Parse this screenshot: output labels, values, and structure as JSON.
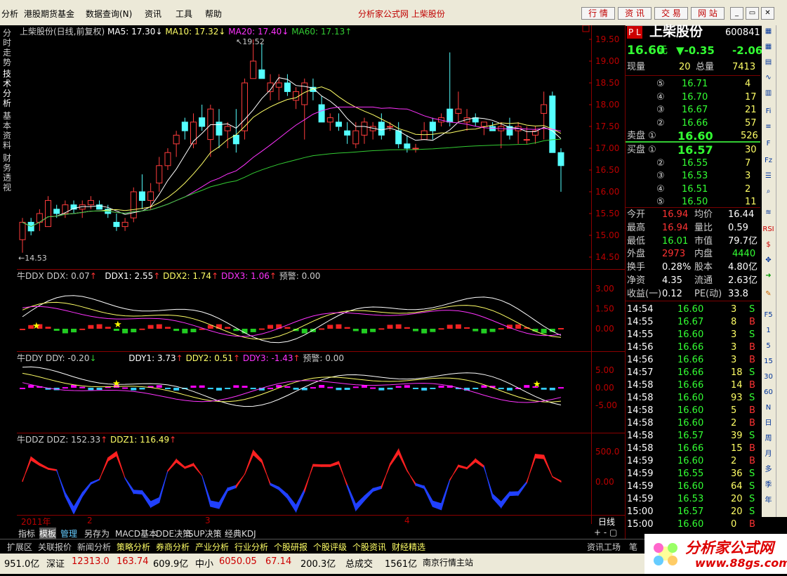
{
  "menu": {
    "items": [
      "分析",
      "港股期货基金",
      "数据查询(N)",
      "资讯",
      "工具",
      "帮助"
    ],
    "window_title": "分析家公式网  上柴股份",
    "top_buttons": [
      "行 情",
      "资 讯",
      "交 易",
      "网 站"
    ]
  },
  "left_tabs": [
    "分时走势",
    "技术分析",
    "基本资料",
    "财务透视"
  ],
  "main_chart": {
    "header": {
      "name": "上柴股份(日线,前复权)",
      "ma5": "MA5: 17.30",
      "ma10": "MA10: 17.32",
      "ma20": "MA20: 17.40",
      "ma60": "MA60: 17.13"
    },
    "y_ticks": [
      "19.50",
      "19.00",
      "18.50",
      "18.00",
      "17.50",
      "17.00",
      "16.50",
      "16.00",
      "15.50",
      "15.00",
      "14.50"
    ],
    "high_label": "19.52",
    "low_label": "14.53",
    "candles": [
      [
        14.9,
        15.4,
        14.6,
        15.3
      ],
      [
        15.3,
        15.4,
        15.0,
        15.1
      ],
      [
        15.3,
        15.6,
        15.1,
        15.5
      ],
      [
        15.2,
        15.9,
        15.2,
        15.8
      ],
      [
        15.6,
        15.7,
        15.4,
        15.5
      ],
      [
        15.5,
        15.8,
        15.4,
        15.7
      ],
      [
        15.7,
        15.8,
        15.5,
        15.6
      ],
      [
        15.6,
        15.8,
        15.4,
        15.7
      ],
      [
        15.7,
        15.9,
        15.6,
        15.8
      ],
      [
        15.7,
        15.8,
        15.6,
        15.6
      ],
      [
        15.6,
        15.7,
        15.4,
        15.5
      ],
      [
        15.3,
        15.5,
        15.1,
        15.2
      ],
      [
        15.2,
        15.4,
        15.1,
        15.3
      ],
      [
        15.4,
        16.1,
        15.3,
        16.0
      ],
      [
        16.0,
        16.4,
        15.6,
        15.8
      ],
      [
        15.8,
        16.2,
        15.6,
        16.0
      ],
      [
        16.2,
        16.8,
        16.0,
        16.6
      ],
      [
        16.6,
        17.0,
        16.5,
        16.9
      ],
      [
        17.1,
        17.4,
        16.8,
        17.3
      ],
      [
        17.6,
        17.7,
        17.2,
        17.4
      ],
      [
        17.1,
        17.8,
        17.0,
        17.6
      ],
      [
        17.7,
        18.0,
        17.4,
        17.5
      ],
      [
        17.2,
        18.0,
        16.8,
        17.9
      ],
      [
        17.6,
        17.9,
        17.0,
        17.3
      ],
      [
        17.4,
        17.6,
        17.0,
        17.5
      ],
      [
        17.3,
        17.9,
        16.9,
        17.1
      ],
      [
        17.4,
        18.6,
        17.2,
        18.5
      ],
      [
        18.6,
        19.5,
        18.6,
        19.0
      ],
      [
        18.8,
        19.4,
        18.6,
        18.6
      ],
      [
        18.3,
        18.7,
        18.1,
        18.5
      ],
      [
        18.4,
        18.7,
        18.1,
        18.5
      ],
      [
        18.5,
        18.7,
        18.2,
        18.3
      ],
      [
        18.1,
        18.4,
        17.9,
        18.3
      ],
      [
        18.0,
        18.6,
        17.2,
        18.5
      ],
      [
        18.4,
        18.6,
        18.1,
        18.3
      ],
      [
        18.0,
        18.2,
        17.6,
        17.6
      ],
      [
        17.6,
        17.8,
        17.4,
        17.7
      ],
      [
        17.6,
        17.8,
        17.4,
        17.5
      ],
      [
        17.4,
        17.6,
        17.1,
        17.3
      ],
      [
        17.1,
        17.6,
        17.0,
        17.4
      ],
      [
        17.3,
        17.7,
        17.1,
        17.6
      ],
      [
        17.4,
        17.6,
        17.2,
        17.5
      ],
      [
        17.6,
        17.8,
        17.2,
        17.3
      ],
      [
        17.5,
        17.6,
        17.4,
        17.5
      ],
      [
        17.4,
        17.6,
        17.0,
        17.1
      ],
      [
        17.1,
        17.3,
        16.9,
        17.0
      ],
      [
        17.0,
        17.1,
        16.9,
        17.0
      ],
      [
        17.2,
        17.6,
        17.2,
        17.4
      ],
      [
        17.6,
        17.7,
        17.2,
        17.4
      ],
      [
        17.6,
        17.8,
        17.5,
        17.7
      ],
      [
        17.9,
        19.2,
        17.5,
        17.6
      ],
      [
        17.8,
        18.3,
        17.6,
        17.9
      ],
      [
        17.6,
        17.9,
        17.4,
        17.7
      ],
      [
        17.7,
        17.8,
        17.5,
        17.6
      ],
      [
        17.5,
        17.6,
        17.3,
        17.6
      ],
      [
        17.5,
        17.6,
        17.4,
        17.4
      ],
      [
        17.4,
        17.6,
        17.0,
        17.5
      ],
      [
        17.5,
        17.7,
        17.2,
        17.3
      ],
      [
        17.4,
        17.6,
        17.1,
        17.5
      ],
      [
        17.2,
        17.5,
        17.1,
        17.2
      ],
      [
        17.3,
        17.5,
        17.1,
        17.4
      ],
      [
        17.8,
        18.3,
        17.2,
        18.0
      ],
      [
        18.2,
        18.3,
        17.0,
        16.9
      ],
      [
        16.9,
        17.0,
        16.0,
        16.6
      ]
    ],
    "ma_colors": {
      "ma5": "#ffffff",
      "ma10": "#ffff66",
      "ma20": "#ff33ff",
      "ma60": "#33cc33"
    }
  },
  "ddx_panel": {
    "name": "牛DDX",
    "ddx": "DDX: 0.07",
    "ddx1": "DDX1: 2.55",
    "ddx2": "DDX2: 1.74",
    "ddx3": "DDX3: 1.06",
    "warn": "预警: 0.00",
    "y_ticks": [
      "3.00",
      "1.50",
      "0.00"
    ]
  },
  "ddy_panel": {
    "name": "牛DDY",
    "ddy": "DDY: -0.20",
    "ddy1": "DDY1: 3.73",
    "ddy2": "DDY2: 0.51",
    "ddy3": "DDY3: -1.43",
    "warn": "预警: 0.00",
    "y_ticks": [
      "5.00",
      "0.00",
      "-5.00"
    ]
  },
  "ddz_panel": {
    "name": "牛DDZ",
    "ddz": "DDZ: 152.33",
    "ddz1": "DDZ1: 116.49",
    "y_ticks": [
      "500.0",
      "0.00"
    ]
  },
  "x_axis": {
    "labels": [
      "2011年",
      "2",
      "3",
      "4"
    ],
    "period": "日线"
  },
  "bottom_tabs": [
    "指标",
    "模板",
    "管理",
    "另存为",
    "MACD基本",
    "DDE决策",
    "SUP决策",
    "经典KDJ"
  ],
  "stock": {
    "flags": "P L",
    "name": "上柴股份",
    "code": "600841",
    "price": "16.60",
    "unit": "元",
    "change": "▼-0.35",
    "pct": "-2.06",
    "cur_vol_label": "现量",
    "cur_vol": "20",
    "total_vol_label": "总量",
    "total_vol": "7413"
  },
  "asks": [
    {
      "n": "⑤",
      "p": "16.71",
      "v": "4"
    },
    {
      "n": "④",
      "p": "16.70",
      "v": "17"
    },
    {
      "n": "③",
      "p": "16.67",
      "v": "21"
    },
    {
      "n": "②",
      "p": "16.66",
      "v": "57"
    },
    {
      "n": "卖盘 ①",
      "p": "16.60",
      "v": "526"
    }
  ],
  "bids": [
    {
      "n": "买盘 ①",
      "p": "16.57",
      "v": "30"
    },
    {
      "n": "②",
      "p": "16.55",
      "v": "7"
    },
    {
      "n": "③",
      "p": "16.53",
      "v": "3"
    },
    {
      "n": "④",
      "p": "16.51",
      "v": "2"
    },
    {
      "n": "⑤",
      "p": "16.50",
      "v": "11"
    }
  ],
  "stats": [
    [
      "今开",
      "16.94",
      "均价",
      "16.44"
    ],
    [
      "最高",
      "16.94",
      "量比",
      "0.59"
    ],
    [
      "最低",
      "16.01",
      "市值",
      "79.7亿"
    ],
    [
      "外盘",
      "2973",
      "内盘",
      "4440"
    ],
    [
      "换手",
      "0.28%",
      "股本",
      "4.80亿"
    ],
    [
      "净资",
      "4.35",
      "流通",
      "2.63亿"
    ],
    [
      "收益(一)",
      "0.12",
      "PE(动)",
      "33.8"
    ]
  ],
  "ticks": [
    [
      "14:54",
      "16.60",
      "3",
      "S"
    ],
    [
      "14:55",
      "16.67",
      "8",
      "B"
    ],
    [
      "14:55",
      "16.60",
      "3",
      "S"
    ],
    [
      "14:56",
      "16.66",
      "3",
      "B"
    ],
    [
      "14:56",
      "16.66",
      "3",
      "B"
    ],
    [
      "14:57",
      "16.66",
      "18",
      "S"
    ],
    [
      "14:58",
      "16.66",
      "14",
      "B"
    ],
    [
      "14:58",
      "16.60",
      "93",
      "S"
    ],
    [
      "14:58",
      "16.60",
      "5",
      "B"
    ],
    [
      "14:58",
      "16.60",
      "2",
      "B"
    ],
    [
      "14:58",
      "16.57",
      "39",
      "S"
    ],
    [
      "14:58",
      "16.66",
      "15",
      "B"
    ],
    [
      "14:59",
      "16.60",
      "2",
      "B"
    ],
    [
      "14:59",
      "16.55",
      "36",
      "S"
    ],
    [
      "14:59",
      "16.60",
      "64",
      "S"
    ],
    [
      "14:59",
      "16.53",
      "20",
      "S"
    ],
    [
      "15:00",
      "16.57",
      "20",
      "S"
    ],
    [
      "15:00",
      "16.60",
      "0",
      "B"
    ]
  ],
  "right_icons": [
    "F5",
    "1",
    "5",
    "15",
    "30",
    "60",
    "N",
    "日",
    "周",
    "月",
    "多",
    "季",
    "年"
  ],
  "hotbar": [
    "扩展区",
    "关联报价",
    "新闻分析",
    "策略分析",
    "券商分析",
    "产业分析",
    "行业分析",
    "个股研报",
    "个股评级",
    "个股资讯",
    "财经精选"
  ],
  "hotbar_right": [
    "资讯工场",
    "笔"
  ],
  "status": [
    "951.0亿",
    "深证",
    "12313.0",
    "163.74",
    "609.9亿",
    "中小",
    "6050.05",
    "67.14",
    "200.3亿",
    "总成交",
    "1561亿",
    "南京行情主站"
  ],
  "logo": {
    "text": "分析家公式网",
    "url": "www.88gs.com"
  }
}
